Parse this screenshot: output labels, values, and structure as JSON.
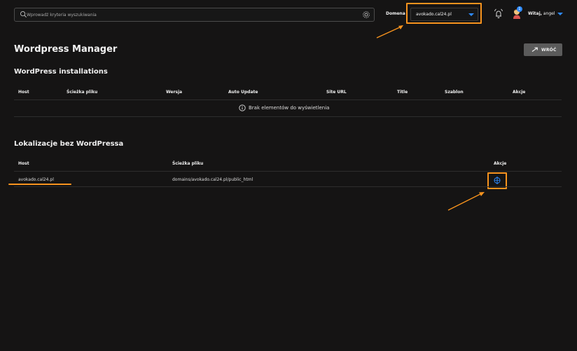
{
  "search": {
    "placeholder": "Wprowadź kryteria wyszukiwania"
  },
  "header": {
    "domain_label": "Domena",
    "domain_value": "avokado.cal24.pl",
    "notification_count": "1",
    "greeting_prefix": "Witaj,",
    "username": "angel"
  },
  "page": {
    "title": "Wordpress Manager",
    "back_label": "WRÓĆ"
  },
  "installations": {
    "title": "WordPress installations",
    "columns": [
      "Host",
      "Ścieżka pliku",
      "Wersja",
      "Auto Update",
      "Site URL",
      "Title",
      "Szablon",
      "Akcje"
    ],
    "empty_message": "Brak elementów do wyświetlenia"
  },
  "without_wp": {
    "title": "Lokalizacje bez WordPressa",
    "columns": [
      "Host",
      "Ścieżka pliku",
      "Akcje"
    ],
    "rows": [
      {
        "host": "avokado.cal24.pl",
        "path": "domains/avokado.cal24.pl/public_html",
        "action_icon": "wordpress-install-icon"
      }
    ]
  },
  "colors": {
    "background": "#151414",
    "highlight": "#f7931e",
    "accent": "#2e8bff",
    "button": "#5b5b5b"
  }
}
